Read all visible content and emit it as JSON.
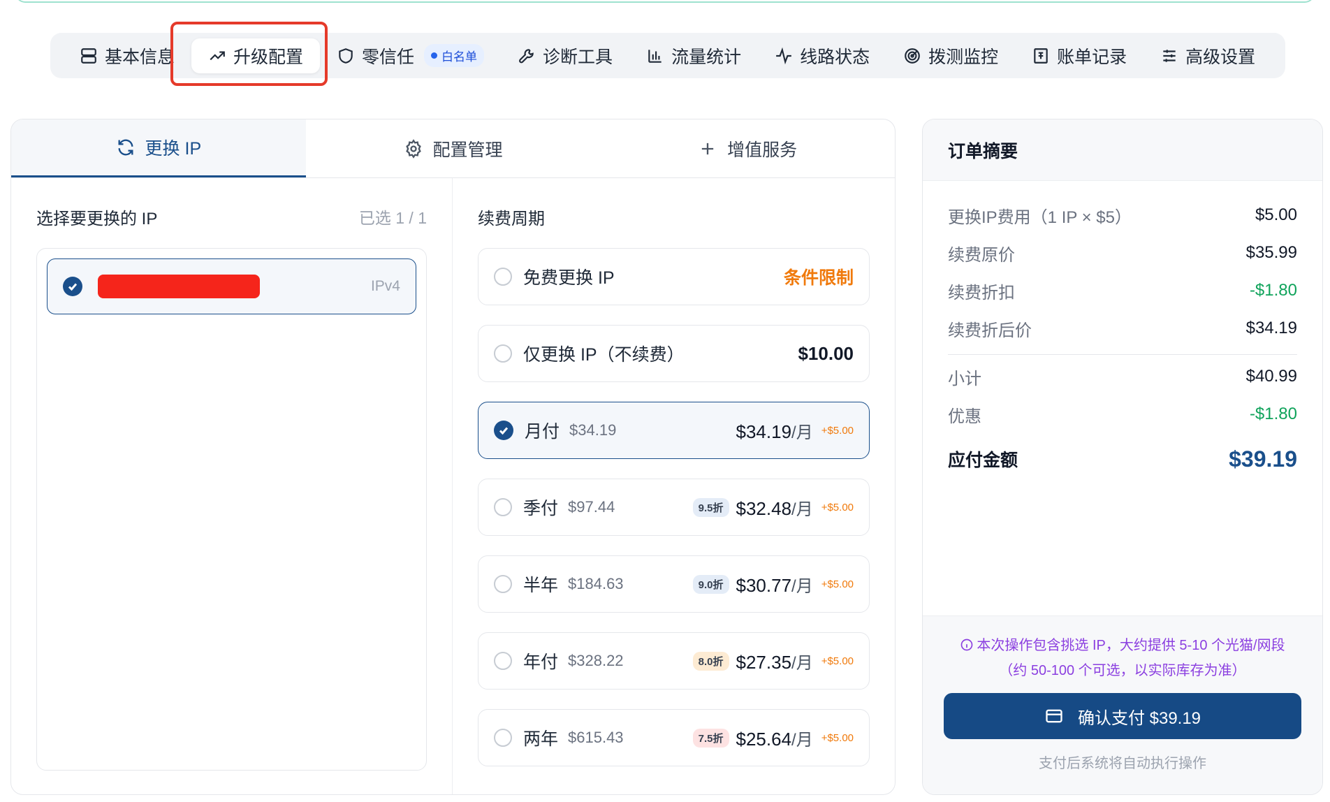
{
  "nav": {
    "items": [
      {
        "label": "基本信息",
        "icon": "server-icon"
      },
      {
        "label": "升级配置",
        "icon": "trend-up-icon",
        "active": true
      },
      {
        "label": "零信任",
        "icon": "shield-icon",
        "badge": "白名单"
      },
      {
        "label": "诊断工具",
        "icon": "wrench-icon"
      },
      {
        "label": "流量统计",
        "icon": "bar-chart-icon"
      },
      {
        "label": "线路状态",
        "icon": "pulse-icon"
      },
      {
        "label": "拨测监控",
        "icon": "radar-icon"
      },
      {
        "label": "账单记录",
        "icon": "receipt-icon"
      },
      {
        "label": "高级设置",
        "icon": "sliders-icon"
      }
    ]
  },
  "tabs": [
    {
      "label": "更换 IP",
      "icon": "refresh-icon",
      "active": true
    },
    {
      "label": "配置管理",
      "icon": "gear-icon"
    },
    {
      "label": "增值服务",
      "icon": "plus-icon"
    }
  ],
  "ip_section": {
    "title": "选择要更换的 IP",
    "count": "已选 1 / 1",
    "items": [
      {
        "type": "IPv4",
        "selected": true
      }
    ]
  },
  "plan_section": {
    "title": "续费周期",
    "plans": [
      {
        "name": "免费更换 IP",
        "tag": "条件限制",
        "selected": false
      },
      {
        "name": "仅更换 IP（不续费）",
        "price": "$10.00",
        "selected": false
      },
      {
        "name": "月付",
        "original": "$34.19",
        "price": "$34.19",
        "unit": "/月",
        "fee": "+$5.00",
        "selected": true
      },
      {
        "name": "季付",
        "original": "$97.44",
        "discount": "9.5折",
        "price": "$32.48",
        "unit": "/月",
        "fee": "+$5.00",
        "selected": false
      },
      {
        "name": "半年",
        "original": "$184.63",
        "discount": "9.0折",
        "price": "$30.77",
        "unit": "/月",
        "fee": "+$5.00",
        "selected": false
      },
      {
        "name": "年付",
        "original": "$328.22",
        "discount": "8.0折",
        "price": "$27.35",
        "unit": "/月",
        "fee": "+$5.00",
        "selected": false
      },
      {
        "name": "两年",
        "original": "$615.43",
        "discount": "7.5折",
        "price": "$25.64",
        "unit": "/月",
        "fee": "+$5.00",
        "selected": false
      }
    ]
  },
  "summary": {
    "title": "订单摘要",
    "rows": [
      {
        "label": "更换IP费用（1 IP × $5）",
        "value": "$5.00"
      },
      {
        "label": "续费原价",
        "value": "$35.99"
      },
      {
        "label": "续费折扣",
        "value": "-$1.80",
        "color": "#10a35b"
      },
      {
        "label": "续费折后价",
        "value": "$34.19"
      }
    ],
    "rows2": [
      {
        "label": "小计",
        "value": "$40.99"
      },
      {
        "label": "优惠",
        "value": "-$1.80",
        "color": "#10a35b"
      }
    ],
    "total_label": "应付金额",
    "total_value": "$39.19",
    "note_line1": "本次操作包含挑选 IP，大约提供 5-10 个光猫/网段",
    "note_line2": "（约 50-100 个可选，以实际库存为准）",
    "pay_label": "确认支付 $39.19",
    "pay_hint": "支付后系统将自动执行操作"
  },
  "colors": {
    "primary": "#1a4f8b",
    "accent_orange": "#f07a0c",
    "green": "#10a35b",
    "note_purple": "#8b3fe0",
    "highlight": "#e53a2a"
  }
}
